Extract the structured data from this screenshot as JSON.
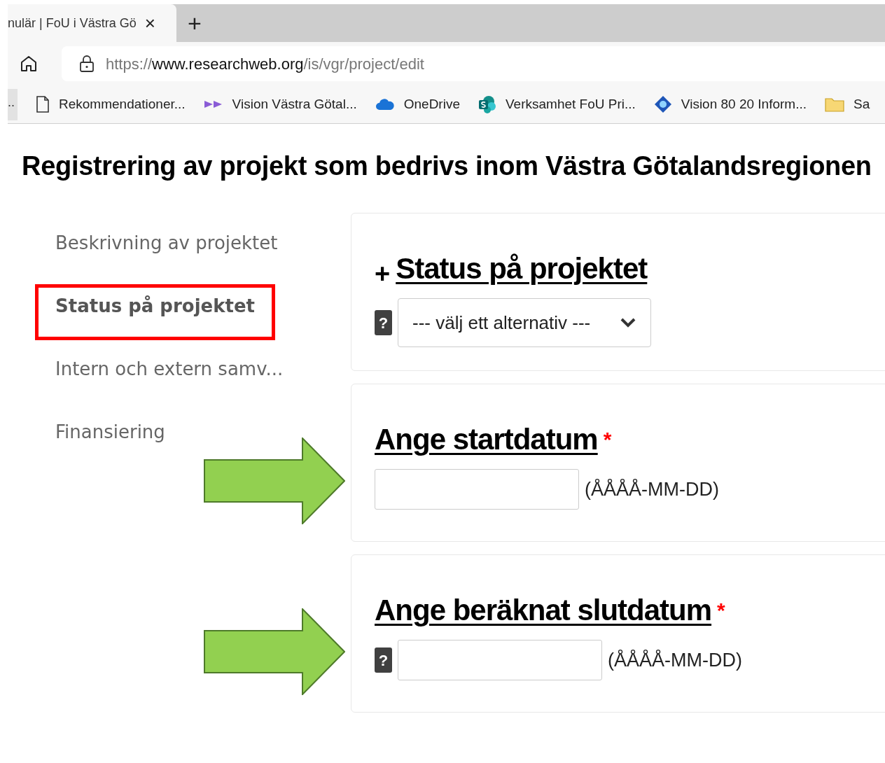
{
  "browser": {
    "tab": {
      "title": "nulär | FoU i Västra Gö",
      "close": "×",
      "new_tab": "+"
    },
    "address": {
      "scheme": "https://",
      "domain": "www.researchweb.org",
      "path": "/is/vgr/project/edit"
    },
    "bookmarks": [
      {
        "kind": "more",
        "label": ".."
      },
      {
        "kind": "page",
        "label": "Rekommendationer..."
      },
      {
        "kind": "arrows",
        "label": "Vision Västra Götal..."
      },
      {
        "kind": "cloud",
        "label": "OneDrive"
      },
      {
        "kind": "sharepoint",
        "label": "Verksamhet FoU Pri..."
      },
      {
        "kind": "diamond",
        "label": "Vision 80 20 Inform..."
      },
      {
        "kind": "folder",
        "label": "Sa"
      }
    ]
  },
  "page_title": "Registrering av projekt som bedrivs inom Västra Götalandsregionen",
  "sidebar": {
    "items": [
      {
        "label": "Beskrivning av projektet",
        "selected": false,
        "highlighted": false
      },
      {
        "label": "Status på projektet",
        "selected": true,
        "highlighted": true
      },
      {
        "label": "Intern och extern samv...",
        "selected": false,
        "highlighted": false
      },
      {
        "label": "Finansiering",
        "selected": false,
        "highlighted": false
      }
    ]
  },
  "sections": [
    {
      "kind": "select",
      "expand": "+",
      "heading": "Status på projektet",
      "help": "?",
      "placeholder": "--- välj ett alternativ ---",
      "arrow": false
    },
    {
      "kind": "date",
      "heading": "Ange startdatum",
      "star": "*",
      "hint": "(ÅÅÅÅ-MM-DD)",
      "arrow": true
    },
    {
      "kind": "date",
      "heading": "Ange beräknat slutdatum",
      "star": "*",
      "help": "?",
      "hint": "(ÅÅÅÅ-MM-DD)",
      "arrow": true
    }
  ]
}
